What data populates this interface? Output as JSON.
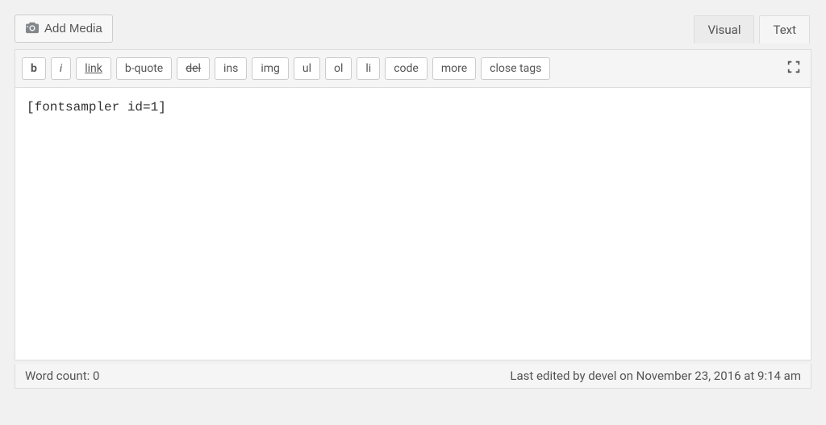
{
  "addMedia": {
    "label": "Add Media"
  },
  "tabs": {
    "visual": "Visual",
    "text": "Text",
    "active": "text"
  },
  "toolbar": {
    "buttons": {
      "bold": "b",
      "italic": "i",
      "link": "link",
      "bquote": "b-quote",
      "del": "del",
      "ins": "ins",
      "img": "img",
      "ul": "ul",
      "ol": "ol",
      "li": "li",
      "code": "code",
      "more": "more",
      "close": "close tags"
    }
  },
  "content": "[fontsampler id=1]",
  "status": {
    "wordCountLabel": "Word count:",
    "wordCount": "0",
    "lastEdited": "Last edited by devel on November 23, 2016 at 9:14 am"
  }
}
